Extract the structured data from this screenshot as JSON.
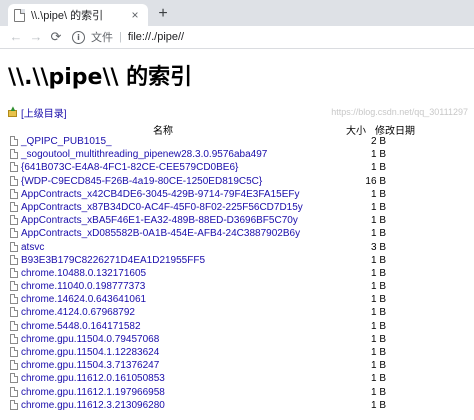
{
  "browser": {
    "tab_title": "\\\\.\\pipe\\ 的索引",
    "tab_close_glyph": "×",
    "new_tab_glyph": "+",
    "back_glyph": "←",
    "forward_glyph": "→",
    "reload_glyph": "⟳",
    "info_glyph": "i",
    "scheme_label": "文件",
    "url_separator": "|",
    "url": "file://./pipe//"
  },
  "page": {
    "heading": "\\\\.\\\\pipe\\\\ 的索引",
    "parent_link": "[上级目录]",
    "columns": {
      "name": "名称",
      "size": "大小",
      "date": "修改日期"
    },
    "files": [
      {
        "name": "_QPIPC_PUB1015_",
        "size": "2 B"
      },
      {
        "name": "_sogoutool_multithreading_pipenew28.3.0.9576aba497",
        "size": "1 B"
      },
      {
        "name": "{641B073C-E4A8-4FC1-82CE-CEE579CD0BE6}",
        "size": "1 B"
      },
      {
        "name": "{WDP-C9ECD845-F26B-4a19-80CE-1250ED819C5C}",
        "size": "16 B"
      },
      {
        "name": "AppContracts_x42CB4DE6-3045-429B-9714-79F4E3FA15EFy",
        "size": "1 B"
      },
      {
        "name": "AppContracts_x87B34DC0-AC4F-45F0-8F02-225F56CD7D15y",
        "size": "1 B"
      },
      {
        "name": "AppContracts_xBA5F46E1-EA32-489B-88ED-D3696BF5C70y",
        "size": "1 B"
      },
      {
        "name": "AppContracts_xD085582B-0A1B-454E-AFB4-24C3887902B6y",
        "size": "1 B"
      },
      {
        "name": "atsvc",
        "size": "3 B"
      },
      {
        "name": "B93E3B179C8226271D4EA1D21955FF5",
        "size": "1 B"
      },
      {
        "name": "chrome.10488.0.132171605",
        "size": "1 B"
      },
      {
        "name": "chrome.11040.0.198777373",
        "size": "1 B"
      },
      {
        "name": "chrome.14624.0.643641061",
        "size": "1 B"
      },
      {
        "name": "chrome.4124.0.67968792",
        "size": "1 B"
      },
      {
        "name": "chrome.5448.0.164171582",
        "size": "1 B"
      },
      {
        "name": "chrome.gpu.11504.0.79457068",
        "size": "1 B"
      },
      {
        "name": "chrome.gpu.11504.1.12283624",
        "size": "1 B"
      },
      {
        "name": "chrome.gpu.11504.3.71376247",
        "size": "1 B"
      },
      {
        "name": "chrome.gpu.11612.0.161050853",
        "size": "1 B"
      },
      {
        "name": "chrome.gpu.11612.1.197966958",
        "size": "1 B"
      },
      {
        "name": "chrome.gpu.11612.3.213096280",
        "size": "1 B"
      }
    ],
    "watermark": "https://blog.csdn.net/qq_30111297"
  }
}
